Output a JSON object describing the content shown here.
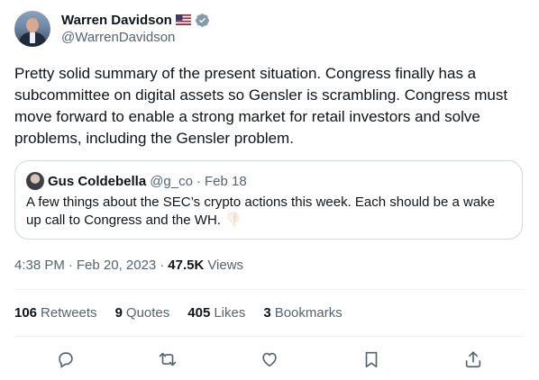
{
  "author": {
    "name": "Warren Davidson",
    "handle": "@WarrenDavidson",
    "flag_emoji": "🇺🇸"
  },
  "tweet": {
    "text": "Pretty solid summary of the present situation. Congress finally has a subcommittee on digital assets so Gensler is scrambling. Congress must move forward to enable a strong market for retail investors and solve problems, including the Gensler problem."
  },
  "quoted_tweet": {
    "name": "Gus Coldebella",
    "handle": "@g_co",
    "separator": "·",
    "date": "Feb 18",
    "text": "A few things about the SEC’s crypto actions this week. Each should be a wake up call to Congress and the WH.",
    "emoji": "👎🏻"
  },
  "meta": {
    "time": "4:38 PM",
    "separator": "·",
    "date": "Feb 20, 2023",
    "views_count": "47.5K",
    "views_label": "Views"
  },
  "stats": [
    {
      "num": "106",
      "label": "Retweets"
    },
    {
      "num": "9",
      "label": "Quotes"
    },
    {
      "num": "405",
      "label": "Likes"
    },
    {
      "num": "3",
      "label": "Bookmarks"
    }
  ],
  "actions": [
    {
      "icon": "reply-icon"
    },
    {
      "icon": "retweet-icon"
    },
    {
      "icon": "like-icon"
    },
    {
      "icon": "bookmark-icon"
    },
    {
      "icon": "share-icon"
    }
  ],
  "colors": {
    "text": "#0f1419",
    "secondary": "#536471",
    "border": "#cfd9de",
    "divider": "#eff3f4",
    "verified": "#829aab"
  }
}
